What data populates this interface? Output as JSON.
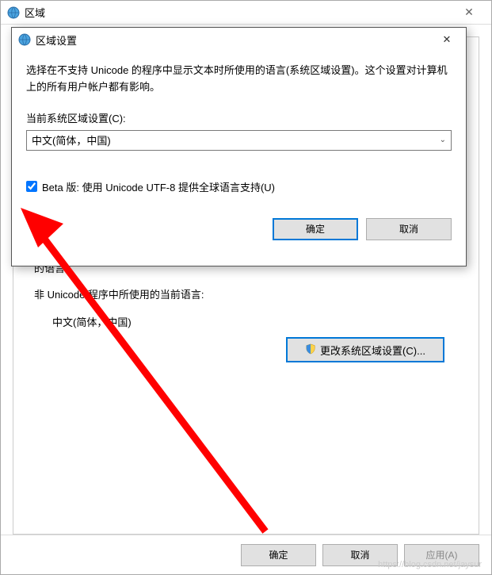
{
  "parent_window": {
    "title": "区域",
    "partial_text1": "的语言。",
    "non_unicode_label": "非 Unicode 程序中所使用的当前语言:",
    "current_locale": "中文(简体，中国)",
    "change_button": "更改系统区域设置(C)...",
    "footer": {
      "ok": "确定",
      "cancel": "取消",
      "apply": "应用(A)"
    }
  },
  "modal": {
    "title": "区域设置",
    "description": "选择在不支持 Unicode 的程序中显示文本时所使用的语言(系统区域设置)。这个设置对计算机上的所有用户帐户都有影响。",
    "current_label": "当前系统区域设置(C):",
    "combo_value": "中文(简体，中国)",
    "beta_checkbox": "Beta 版: 使用 Unicode UTF-8 提供全球语言支持(U)",
    "beta_checked": true,
    "ok": "确定",
    "cancel": "取消"
  },
  "watermark": "https://blog.csdn.net/jaysur"
}
